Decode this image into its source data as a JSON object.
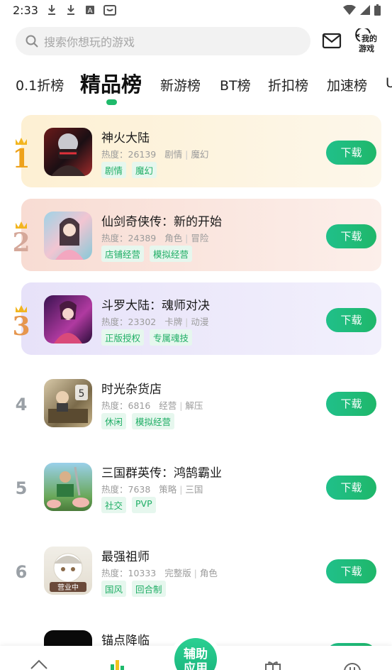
{
  "status_bar": {
    "time": "2:33"
  },
  "header": {
    "search_placeholder": "搜索你想玩的游戏",
    "my_games_label_1": "我的",
    "my_games_label_2": "游戏"
  },
  "tabs": [
    {
      "label": "0.1折榜"
    },
    {
      "label": "精品榜",
      "active": true
    },
    {
      "label": "新游榜"
    },
    {
      "label": "BT榜"
    },
    {
      "label": "折扣榜"
    },
    {
      "label": "加速榜"
    },
    {
      "label": "U"
    }
  ],
  "games": [
    {
      "rank": "1",
      "title": "神火大陆",
      "heat_label": "热度：26139",
      "cat1": "剧情",
      "cat2": "魔幻",
      "tags": [
        "剧情",
        "魔幻"
      ],
      "button": "下载"
    },
    {
      "rank": "2",
      "title": "仙剑奇侠传：新的开始",
      "heat_label": "热度：24389",
      "cat1": "角色",
      "cat2": "冒险",
      "tags": [
        "店铺经营",
        "模拟经营"
      ],
      "button": "下载"
    },
    {
      "rank": "3",
      "title": "斗罗大陆：魂师对决",
      "heat_label": "热度：23302",
      "cat1": "卡牌",
      "cat2": "动漫",
      "tags": [
        "正版授权",
        "专属魂技"
      ],
      "button": "下载"
    },
    {
      "rank": "4",
      "title": "时光杂货店",
      "heat_label": "热度：6816",
      "cat1": "经营",
      "cat2": "解压",
      "tags": [
        "休闲",
        "模拟经营"
      ],
      "button": "下载"
    },
    {
      "rank": "5",
      "title": "三国群英传：鸿鹄霸业",
      "heat_label": "热度：7638",
      "cat1": "策略",
      "cat2": "三国",
      "tags": [
        "社交",
        "PVP"
      ],
      "button": "下载"
    },
    {
      "rank": "6",
      "title": "最强祖师",
      "heat_label": "热度：10333",
      "cat1": "完整版",
      "cat2": "角色",
      "tags": [
        "国风",
        "回合制"
      ],
      "button": "下载"
    },
    {
      "rank": "7",
      "title": "锚点降临",
      "heat_label": "",
      "cat1": "",
      "cat2": "",
      "tags": [],
      "button": ""
    }
  ],
  "bottom_nav": {
    "assist_label_1": "辅助",
    "assist_label_2": "应用"
  },
  "colors": {
    "accent": "#1fba6b",
    "rank1_bg": "#fdf3dc",
    "rank2_bg": "#f9e3dc",
    "rank3_bg": "#ece9fa"
  }
}
